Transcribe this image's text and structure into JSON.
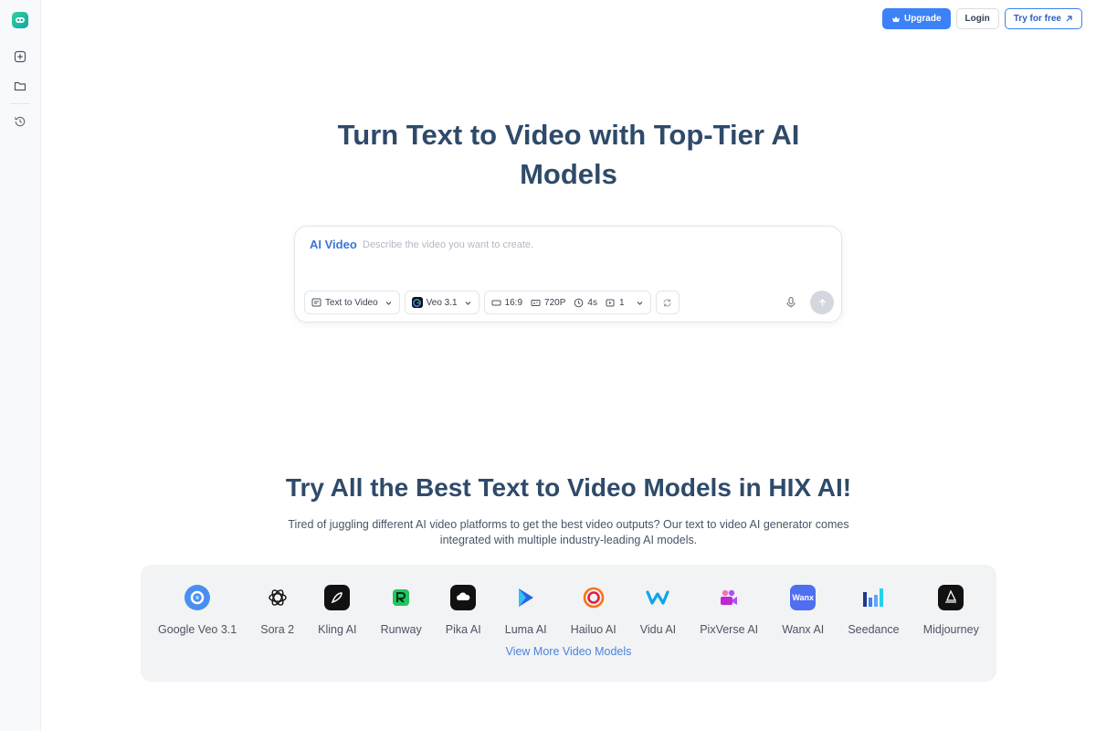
{
  "topbar": {
    "upgrade_label": "Upgrade",
    "login_label": "Login",
    "try_label": "Try for free"
  },
  "hero": {
    "title_line1": "Turn Text to Video with Top-Tier AI",
    "title_line2": "Models"
  },
  "prompt": {
    "label": "AI Video",
    "placeholder": "Describe the video you want to create.",
    "mode": "Text to Video",
    "model": "Veo 3.1",
    "aspect_ratio": "16:9",
    "resolution": "720P",
    "duration": "4s",
    "count": "1"
  },
  "section": {
    "title": "Try All the Best Text to Video Models in HIX AI!",
    "description": "Tired of juggling different AI video platforms to get the best video outputs? Our text to video AI generator comes integrated with multiple industry-leading AI models.",
    "view_more": "View More Video Models"
  },
  "models": [
    {
      "name": "Google Veo 3.1",
      "icon": "google-veo-icon",
      "color": "#4a8ff0"
    },
    {
      "name": "Sora 2",
      "icon": "openai-icon",
      "color": "#ffffff"
    },
    {
      "name": "Kling AI",
      "icon": "kling-icon",
      "color": "#111111"
    },
    {
      "name": "Runway",
      "icon": "runway-icon",
      "color": "#e8fbe8"
    },
    {
      "name": "Pika AI",
      "icon": "pika-icon",
      "color": "#111111"
    },
    {
      "name": "Luma AI",
      "icon": "luma-icon",
      "color": "#3b82f6"
    },
    {
      "name": "Hailuo AI",
      "icon": "hailuo-icon",
      "color": "#f05a7e"
    },
    {
      "name": "Vidu AI",
      "icon": "vidu-icon",
      "color": "#2ea8f0"
    },
    {
      "name": "PixVerse AI",
      "icon": "pixverse-icon",
      "color": "#c45bd8"
    },
    {
      "name": "Wanx AI",
      "icon": "wanx-icon",
      "color": "#4f6ef0",
      "badge_text": "Wanx"
    },
    {
      "name": "Seedance",
      "icon": "seedance-icon",
      "color": "#2e8fd8"
    },
    {
      "name": "Midjourney",
      "icon": "midjourney-icon",
      "color": "#111111"
    }
  ],
  "colors": {
    "accent": "#3b82f6",
    "heading": "#2f4a6a",
    "brand": "#10b9a3"
  }
}
